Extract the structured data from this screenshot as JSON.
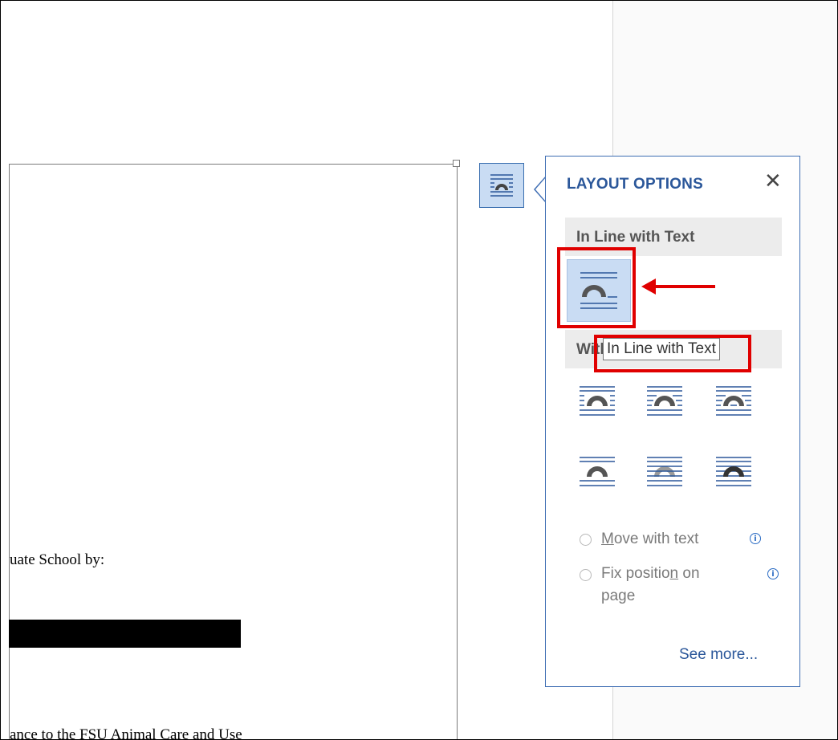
{
  "document": {
    "line1": "uate School by:",
    "line2": "ance to the FSU Animal Care and Use"
  },
  "panel": {
    "title": "LAYOUT OPTIONS",
    "close_label": "✕",
    "inline_section": "In Line with Text",
    "wrap_section": "With Text Wrapping",
    "move_with_text_pre": "",
    "move_with_text_u": "M",
    "move_with_text_post": "ove with text",
    "fix_position_pre": "Fix positio",
    "fix_position_u": "n",
    "fix_position_post": " on",
    "fix_position_line2": "page",
    "see_more": "See more..."
  },
  "tooltip": {
    "text": "In Line with Text"
  },
  "icons": {
    "layout_button": "layout-options-icon",
    "inline": "inline-with-text-icon",
    "wrap_options": [
      "square-wrap-icon",
      "tight-wrap-icon",
      "through-wrap-icon",
      "top-bottom-wrap-icon",
      "behind-text-icon",
      "in-front-of-text-icon"
    ]
  },
  "colors": {
    "accent": "#2b579a",
    "highlight": "#e00000",
    "selected_bg": "#c9dcf3"
  }
}
